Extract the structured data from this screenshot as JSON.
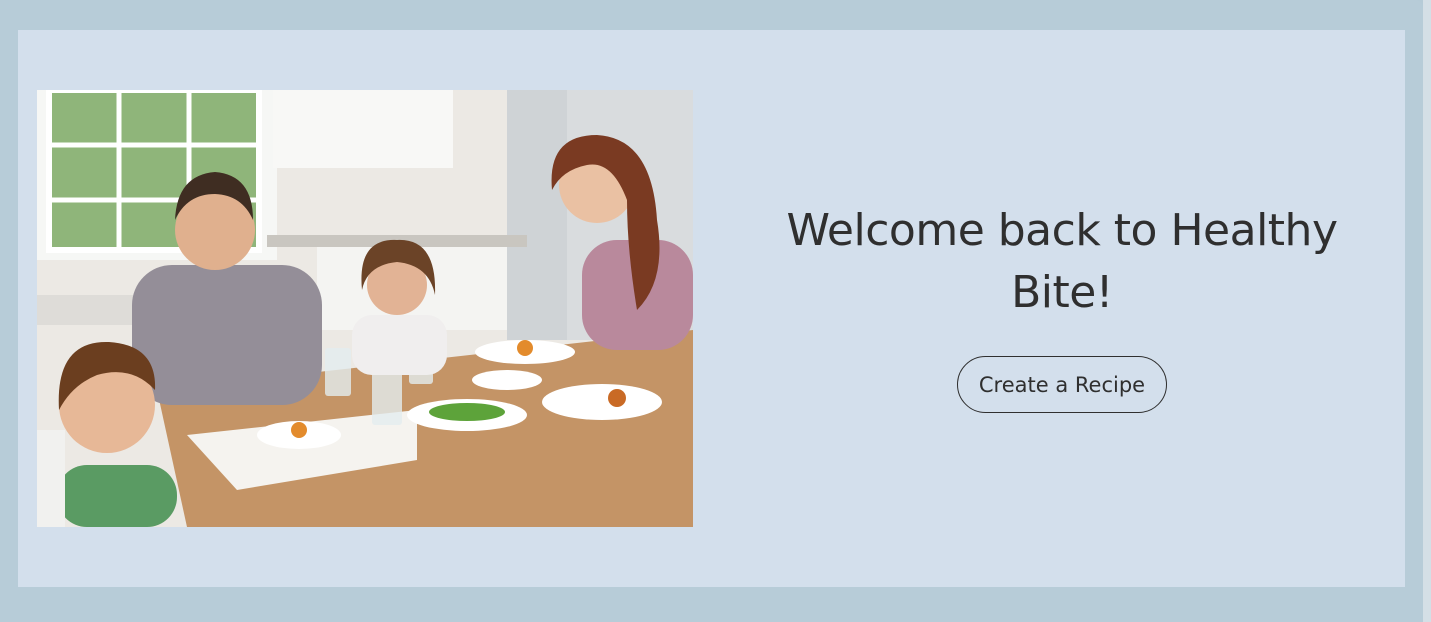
{
  "hero": {
    "title": "Welcome back to Healthy Bite!",
    "create_button_label": "Create a Recipe",
    "image_alt": "family eating a healthy meal together"
  },
  "colors": {
    "page_background": "#b6cbd7",
    "card_background": "#d3dfec",
    "text": "#2f2f2f"
  }
}
